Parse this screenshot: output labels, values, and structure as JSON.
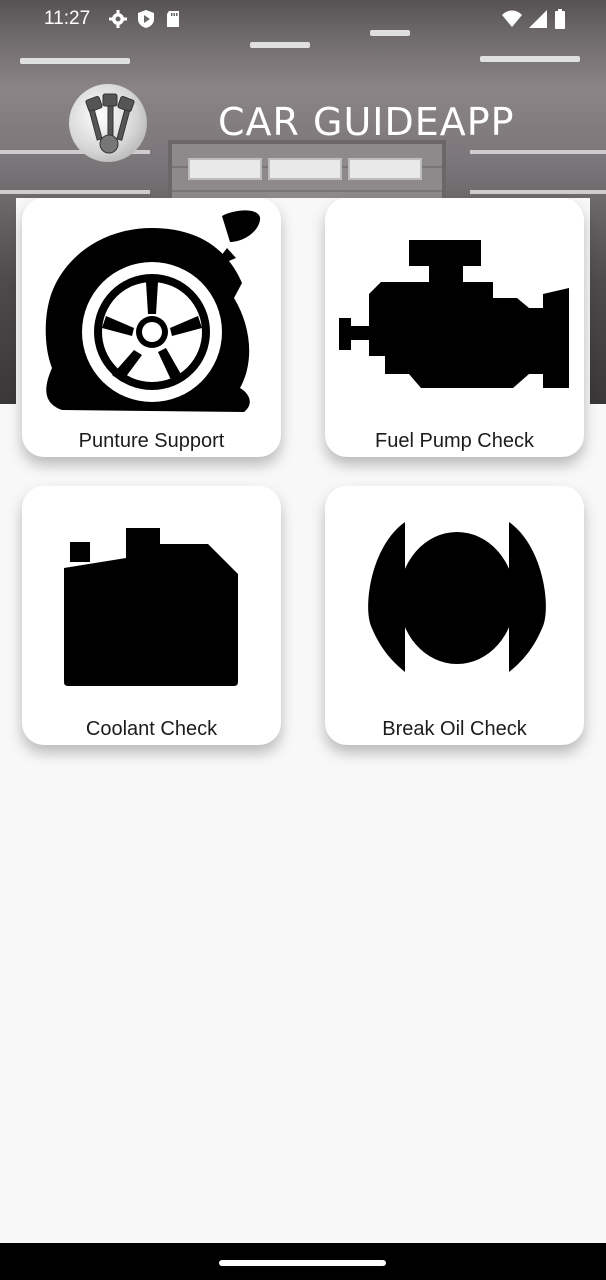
{
  "status_bar": {
    "time": "11:27",
    "left_icons": [
      "settings-icon",
      "play-protect-icon",
      "sd-card-icon"
    ],
    "right_icons": [
      "wifi-icon",
      "signal-icon",
      "battery-icon"
    ]
  },
  "header": {
    "title": "CAR GUIDEAPP",
    "logo_icon": "engine-pistons-icon"
  },
  "cards": [
    {
      "label": "Punture Support",
      "icon": "flat-tire-icon"
    },
    {
      "label": "Fuel Pump Check",
      "icon": "engine-icon"
    },
    {
      "label": "Coolant Check",
      "icon": "coolant-jug-icon"
    },
    {
      "label": "Break Oil Check",
      "icon": "brake-icon"
    }
  ],
  "colors": {
    "card_background": "#ffffff",
    "page_background": "#f8f8f8",
    "icon_color": "#000000",
    "nav_bar": "#000000"
  }
}
